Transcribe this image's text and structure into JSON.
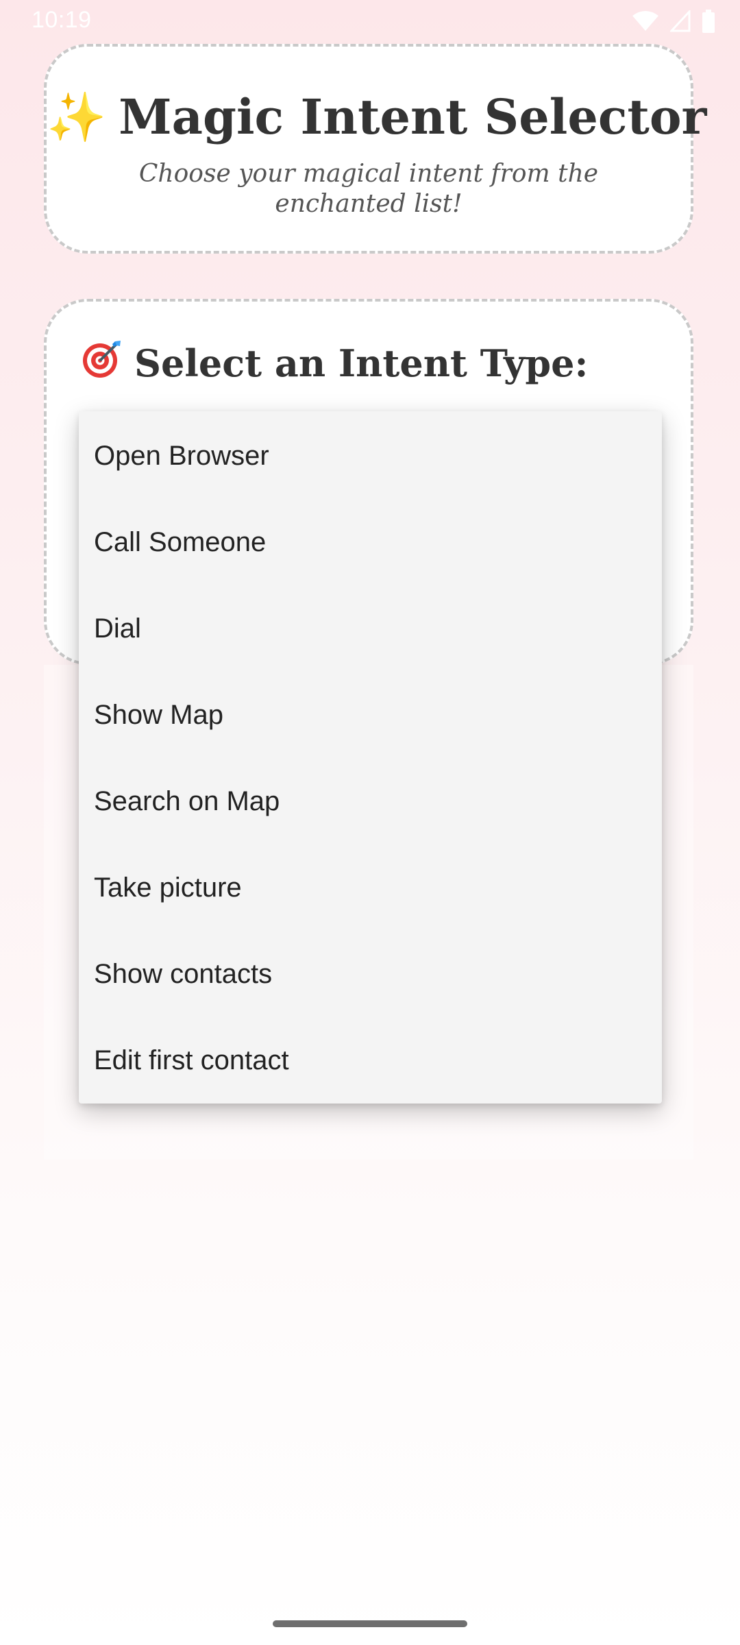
{
  "status_bar": {
    "time": "10:19",
    "icons": [
      "wifi-icon",
      "cellular-signal-icon",
      "battery-icon"
    ]
  },
  "header": {
    "sparkle_icon": "✨",
    "title": "Magic Intent Selector",
    "subtitle": "Choose your magical intent from the enchanted list!"
  },
  "selector": {
    "target_icon": "target-dart-icon",
    "title": "Select an Intent Type:"
  },
  "dropdown": {
    "items": [
      {
        "label": "Open Browser"
      },
      {
        "label": "Call Someone"
      },
      {
        "label": "Dial"
      },
      {
        "label": "Show Map"
      },
      {
        "label": "Search on Map"
      },
      {
        "label": "Take picture"
      },
      {
        "label": "Show contacts"
      },
      {
        "label": "Edit first contact"
      }
    ]
  },
  "colors": {
    "background_top": "#fde7ea",
    "card_border": "#c9c9c9",
    "menu_background": "#f4f4f4",
    "text_primary": "#333333"
  }
}
